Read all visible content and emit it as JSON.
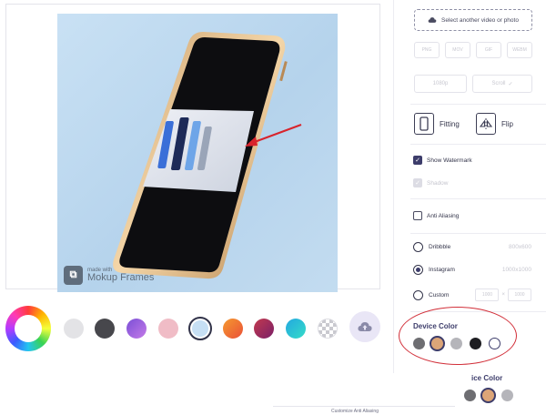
{
  "canvas": {
    "watermark": {
      "logo_glyph": "⧉",
      "small": "made with",
      "big": "Mokup Frames"
    },
    "screen_content": "phone-lineup-image"
  },
  "backgrounds": {
    "swatches": [
      {
        "name": "bg-swatch-light-gray",
        "color": "#e3e3e6"
      },
      {
        "name": "bg-swatch-dark-gray",
        "color": "#47474c"
      },
      {
        "name": "bg-swatch-purple",
        "color": "#9a5fd8"
      },
      {
        "name": "bg-swatch-pink",
        "color": "#f0bcc6"
      },
      {
        "name": "bg-swatch-light-blue",
        "color": "#c6dff4",
        "selected": true
      },
      {
        "name": "bg-swatch-orange",
        "color": "#f17836"
      },
      {
        "name": "bg-swatch-magenta",
        "color": "#a3265a"
      },
      {
        "name": "bg-swatch-teal",
        "color": "#2cc5dc"
      },
      {
        "name": "bg-swatch-transparent",
        "color": "checker"
      }
    ],
    "upload_icon": "cloud-upload-icon"
  },
  "panel": {
    "select_label": "Select another video or photo",
    "formats": [
      "PNG",
      "MOV",
      "GIF",
      "WEBM"
    ],
    "quality_label": "1080p",
    "duration_label": "Scroll",
    "fitting_label": "Fitting",
    "flip_label": "Flip",
    "show_watermark": "Show Watermark",
    "shadow_label": "Shadow",
    "anti_aliasing": "Anti Aliasing",
    "dribbble_label": "Dribbble",
    "dribbble_size": "800x600",
    "instagram_label": "Instagram",
    "instagram_size": "1000x1000",
    "custom_label": "Custom",
    "custom_w": "1000",
    "custom_x": "×",
    "custom_h": "1000"
  },
  "device_color": {
    "title": "Device Color",
    "colors": [
      {
        "name": "device-color-space-gray",
        "color": "#6e6e72"
      },
      {
        "name": "device-color-gold",
        "color": "#dca578",
        "selected": true
      },
      {
        "name": "device-color-silver",
        "color": "#b5b5ba"
      },
      {
        "name": "device-color-black",
        "color": "#1e1e22"
      },
      {
        "name": "device-color-white",
        "color": "#ffffff"
      }
    ]
  },
  "zoom_preview": {
    "title": "ice Color",
    "colors": [
      "#6e6e72",
      "#dca578",
      "#b5b5ba"
    ]
  },
  "footer": {
    "text": "Customize Anti Aliasing"
  }
}
